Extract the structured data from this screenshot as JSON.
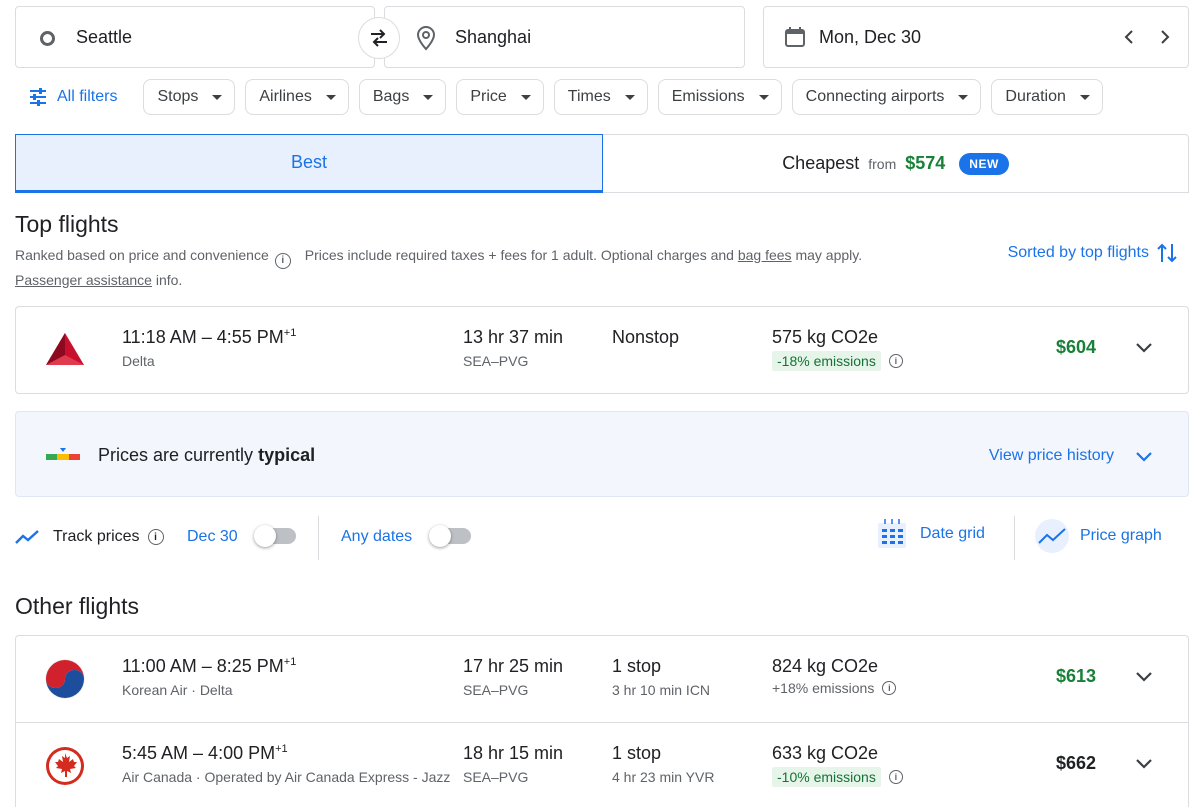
{
  "search": {
    "origin": "Seattle",
    "destination": "Shanghai",
    "date": "Mon, Dec 30"
  },
  "filters": {
    "all_filters": "All filters",
    "chips": [
      "Stops",
      "Airlines",
      "Bags",
      "Price",
      "Times",
      "Emissions",
      "Connecting airports",
      "Duration"
    ]
  },
  "tabs": {
    "best": "Best",
    "cheapest": "Cheapest",
    "from": "from",
    "cheapest_price": "$574",
    "new_badge": "NEW"
  },
  "top_flights": {
    "title": "Top flights",
    "ranked": "Ranked based on price and convenience",
    "prices_note": "Prices include required taxes + fees for 1 adult. Optional charges and",
    "bag_fees": "bag fees",
    "may_apply": "may apply.",
    "passenger_assistance": "Passenger assistance",
    "info": "info.",
    "sorted_by": "Sorted by top flights"
  },
  "flights_top": [
    {
      "times": "11:18 AM – 4:55 PM",
      "plus_day": "+1",
      "airline": "Delta",
      "duration": "13 hr 37 min",
      "route": "SEA–PVG",
      "stops": "Nonstop",
      "layover": "",
      "co2": "575 kg CO2e",
      "emissions": "-18% emissions",
      "price": "$604"
    }
  ],
  "insight": {
    "prefix": "Prices are currently",
    "level": "typical",
    "view_history": "View price history"
  },
  "track": {
    "label": "Track prices",
    "date": "Dec 30",
    "any_dates": "Any dates",
    "date_grid": "Date grid",
    "price_graph": "Price graph"
  },
  "other_flights": {
    "title": "Other flights"
  },
  "flights_other": [
    {
      "times": "11:00 AM – 8:25 PM",
      "plus_day": "+1",
      "airline": "Korean Air · Delta",
      "duration": "17 hr 25 min",
      "route": "SEA–PVG",
      "stops": "1 stop",
      "layover": "3 hr 10 min ICN",
      "co2": "824 kg CO2e",
      "emissions": "+18% emissions",
      "price": "$613"
    },
    {
      "times": "5:45 AM – 4:00 PM",
      "plus_day": "+1",
      "airline": "Air Canada · Operated by Air Canada Express - Jazz",
      "duration": "18 hr 15 min",
      "route": "SEA–PVG",
      "stops": "1 stop",
      "layover": "4 hr 23 min YVR",
      "co2": "633 kg CO2e",
      "emissions": "-10% emissions",
      "price": "$662"
    }
  ],
  "colors": {
    "accent": "#1a73e8",
    "price_green": "#188038",
    "delta_red": "#c8102e",
    "aircanada_red": "#d52b1e"
  }
}
